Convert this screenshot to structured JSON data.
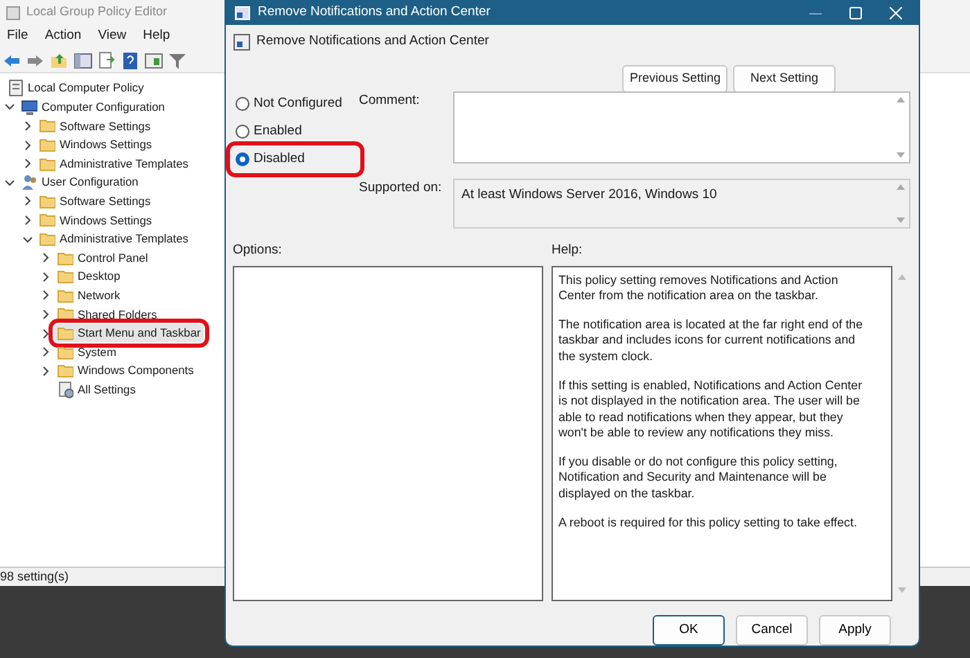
{
  "editor": {
    "title": "Local Group Policy Editor",
    "menu": [
      "File",
      "Action",
      "View",
      "Help"
    ],
    "tree": [
      {
        "label": "Local Computer Policy",
        "kind": "policy",
        "selected": false,
        "children": [
          {
            "label": "Computer Configuration",
            "kind": "computer",
            "expanded": true,
            "selected": false,
            "children": [
              {
                "label": "Software Settings",
                "kind": "folder",
                "expanded": false,
                "selected": false
              },
              {
                "label": "Windows Settings",
                "kind": "folder",
                "expanded": false,
                "selected": false
              },
              {
                "label": "Administrative Templates",
                "kind": "folder",
                "expanded": false,
                "selected": false
              }
            ]
          },
          {
            "label": "User Configuration",
            "kind": "user",
            "expanded": true,
            "selected": false,
            "children": [
              {
                "label": "Software Settings",
                "kind": "folder",
                "expanded": false,
                "selected": false
              },
              {
                "label": "Windows Settings",
                "kind": "folder",
                "expanded": false,
                "selected": false
              },
              {
                "label": "Administrative Templates",
                "kind": "folder",
                "expanded": true,
                "selected": false,
                "children": [
                  {
                    "label": "Control Panel",
                    "kind": "folder",
                    "expanded": false,
                    "selected": false
                  },
                  {
                    "label": "Desktop",
                    "kind": "folder",
                    "expanded": false,
                    "selected": false
                  },
                  {
                    "label": "Network",
                    "kind": "folder",
                    "expanded": false,
                    "selected": false
                  },
                  {
                    "label": "Shared Folders",
                    "kind": "folder",
                    "expanded": false,
                    "selected": false
                  },
                  {
                    "label": "Start Menu and Taskbar",
                    "kind": "folder",
                    "expanded": false,
                    "selected": true,
                    "highlighted": true
                  },
                  {
                    "label": "System",
                    "kind": "folder",
                    "expanded": false,
                    "selected": false
                  },
                  {
                    "label": "Windows Components",
                    "kind": "folder",
                    "expanded": false,
                    "selected": false
                  },
                  {
                    "label": "All Settings",
                    "kind": "settings",
                    "selected": false
                  }
                ]
              }
            ]
          }
        ]
      }
    ],
    "status_bar": "98 setting(s)"
  },
  "dialog": {
    "title": "Remove Notifications and Action Center",
    "setting_name": "Remove Notifications and Action Center",
    "nav_buttons": [
      "Previous Setting",
      "Next Setting"
    ],
    "options": [
      {
        "label": "Not Configured",
        "selected": false,
        "highlighted": false
      },
      {
        "label": "Enabled",
        "selected": false,
        "highlighted": false
      },
      {
        "label": "Disabled",
        "selected": true,
        "highlighted": true
      }
    ],
    "comment_label": "Comment:",
    "supported_label": "Supported on:",
    "supported_value": "At least Windows Server 2016, Windows 10",
    "options_label": "Options:",
    "help_label": "Help:",
    "help_text": [
      "This policy setting removes Notifications and Action Center from the notification area on the taskbar.",
      "The notification area is located at the far right end of the taskbar and includes icons for current notifications and the system clock.",
      "If this setting is enabled, Notifications and Action Center is not displayed in the notification area. The user will be able to read notifications when they appear, but they won't be able to review any notifications they miss.",
      "If you disable or do not configure this policy setting, Notification and Security and Maintenance will be displayed on the taskbar.",
      "A reboot is required for this policy setting to take effect."
    ],
    "buttons": [
      {
        "label": "OK",
        "kind": "default"
      },
      {
        "label": "Cancel",
        "kind": "normal"
      },
      {
        "label": "Apply",
        "kind": "normal"
      }
    ]
  }
}
